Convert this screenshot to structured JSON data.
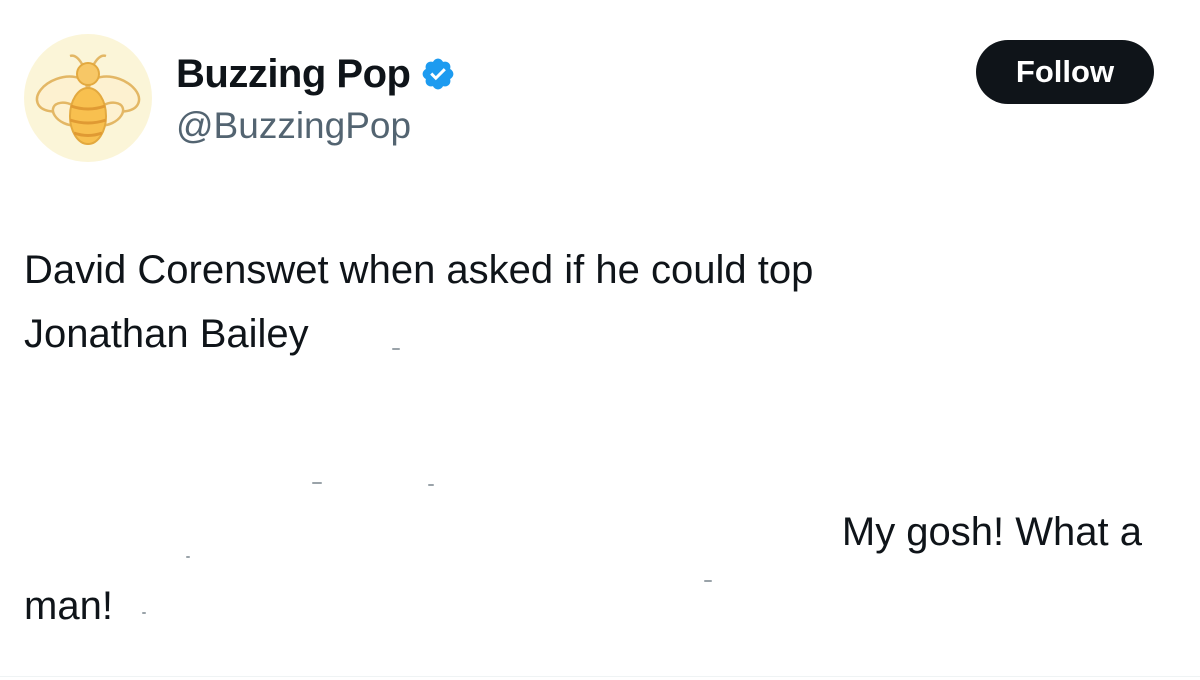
{
  "account": {
    "display_name": "Buzzing Pop",
    "handle": "@BuzzingPop",
    "verified": true,
    "avatar_icon": "bee-icon",
    "verified_color": "#1d9bf0"
  },
  "actions": {
    "follow_label": "Follow"
  },
  "tweet": {
    "line1": "David Corenswet when asked if he could top",
    "line2": "Jonathan Bailey",
    "line3": "My gosh! What a",
    "line4": "man!"
  }
}
